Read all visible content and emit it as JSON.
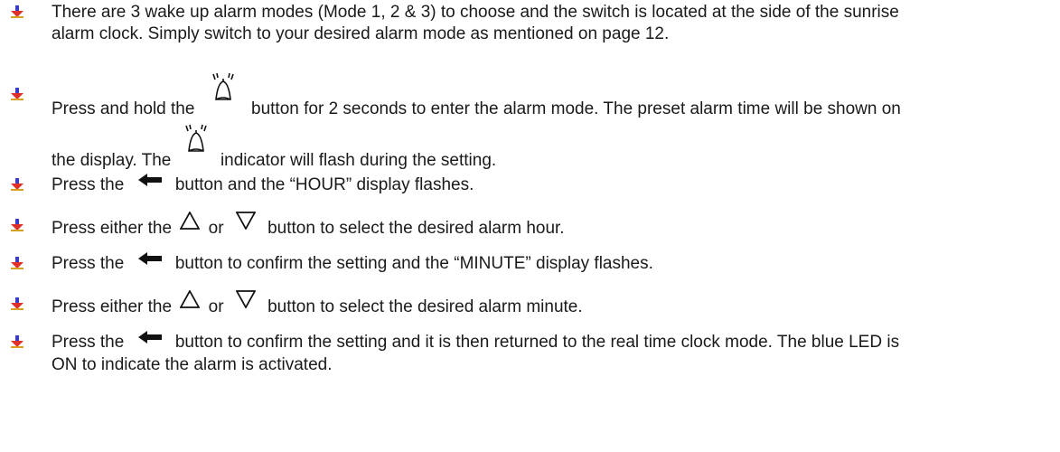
{
  "colors": {
    "text": "#1a1a1a",
    "bullet_red": "#e0302a",
    "bullet_blue": "#3a3ad8",
    "bullet_gold": "#d8a020"
  },
  "icons": {
    "bullet": "arrow-down-bullet-icon",
    "alarm": "alarm-bell-icon",
    "set": "left-arrow-icon",
    "up": "up-triangle-icon",
    "down": "down-triangle-icon"
  },
  "items": [
    {
      "line1": "There are 3 wake up alarm modes (Mode 1, 2 & 3) to choose and the switch is located at the side of the sunrise",
      "line2": "alarm clock.  Simply switch to your desired alarm mode as mentioned on page 12."
    },
    {
      "a": "Press and hold the",
      "b": "button for 2 seconds to enter the alarm mode.  The preset alarm time will be shown on",
      "c": "the display.  The",
      "d": "indicator will flash during the setting."
    },
    {
      "a": "Press the",
      "b": "button and the “HOUR” display flashes."
    },
    {
      "a": "Press either the",
      "b": "or",
      "c": "button to select the desired alarm hour."
    },
    {
      "a": "Press the",
      "b": "button to confirm the setting and the “MINUTE” display flashes."
    },
    {
      "a": "Press either the",
      "b": "or",
      "c": "button to select the desired alarm minute."
    },
    {
      "a": "Press the",
      "b": "button to confirm the setting and it is then returned to the real time clock mode.  The blue LED is",
      "line2": "ON to indicate the alarm is activated."
    }
  ]
}
